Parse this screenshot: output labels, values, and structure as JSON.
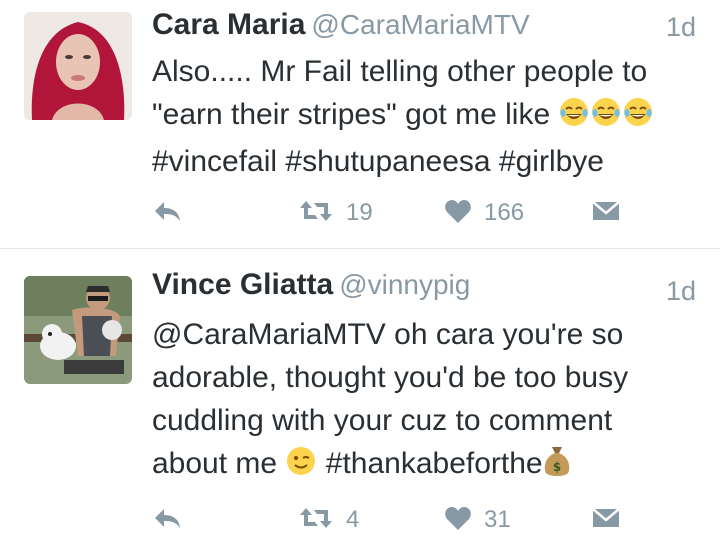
{
  "tweets": [
    {
      "name": "Cara Maria",
      "handle": "@CaraMariaMTV",
      "time": "1d",
      "lines": [
        "Also..... Mr Fail telling other people to",
        "\"earn their stripes\" got me like ",
        "#vincefail #shutupaneesa #girlbye"
      ],
      "line2_emoji": [
        "tears-of-joy-emoji",
        "tears-of-joy-emoji",
        "tears-of-joy-emoji"
      ],
      "retweets": "19",
      "likes": "166"
    },
    {
      "name": "Vince Gliatta",
      "handle": "@vinnypig",
      "time": "1d",
      "lines": [
        "@CaraMariaMTV oh cara you're so",
        "adorable, thought you'd be too busy",
        "cuddling with your cuz to comment",
        "about me ",
        " #thankabeforthe"
      ],
      "line4_emoji": [
        "wink-emoji",
        "money-bag-emoji"
      ],
      "retweets": "4",
      "likes": "31"
    }
  ],
  "icons": [
    "reply-icon",
    "retweet-icon",
    "like-icon",
    "direct-message-icon"
  ],
  "colors": {
    "icon": "#8899a6",
    "text": "#292f33",
    "secondary": "#8899a6",
    "divider": "#e1e8ed",
    "emoji": "#fcd34d"
  }
}
